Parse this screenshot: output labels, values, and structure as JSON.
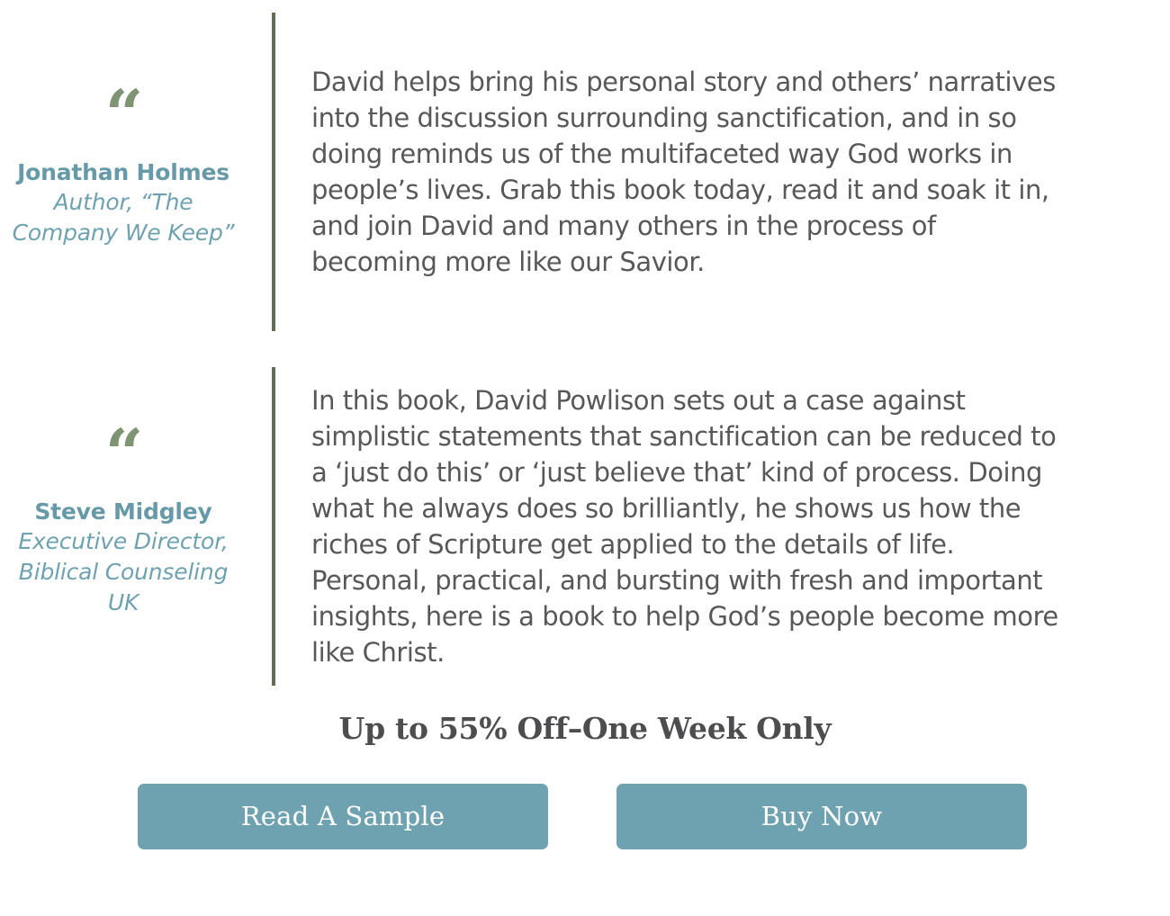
{
  "colors": {
    "accent_teal": "#6fa2b0",
    "name_teal": "#679aa8",
    "divider_green": "#5f6f52",
    "quote_glyph_green": "#7f9472",
    "body_text_gray": "#58585a",
    "headline_gray": "#4d4d4f",
    "background": "#ffffff",
    "button_text": "#ffffff"
  },
  "testimonials": [
    {
      "quote_mark": "“",
      "name": "Jonathan Holmes",
      "title": "Author, “The Company We Keep”",
      "quote": "David helps bring his personal story and others’ narratives into the discussion surrounding sanctification, and in so doing reminds us of the multifaceted way God works in people’s lives. Grab this book today, read it and soak it in, and join David and many others in the process of becoming more like our Savior."
    },
    {
      "quote_mark": "“",
      "name": "Steve Midgley",
      "title": "Executive Director, Biblical Counseling UK",
      "quote": "In this book, David Powlison sets out a case against simplistic statements that sanctification can be reduced to a ‘just do this’ or ‘just believe that’ kind of process. Doing what he always does so brilliantly, he shows us how the riches of Scripture get applied to the details of life. Personal, practical, and bursting with fresh and important insights, here is a book to help God’s people become more like Christ."
    }
  ],
  "promo": {
    "headline": "Up to 55% Off–One Week Only"
  },
  "cta": {
    "read_sample_label": "Read A Sample",
    "buy_now_label": "Buy Now"
  }
}
